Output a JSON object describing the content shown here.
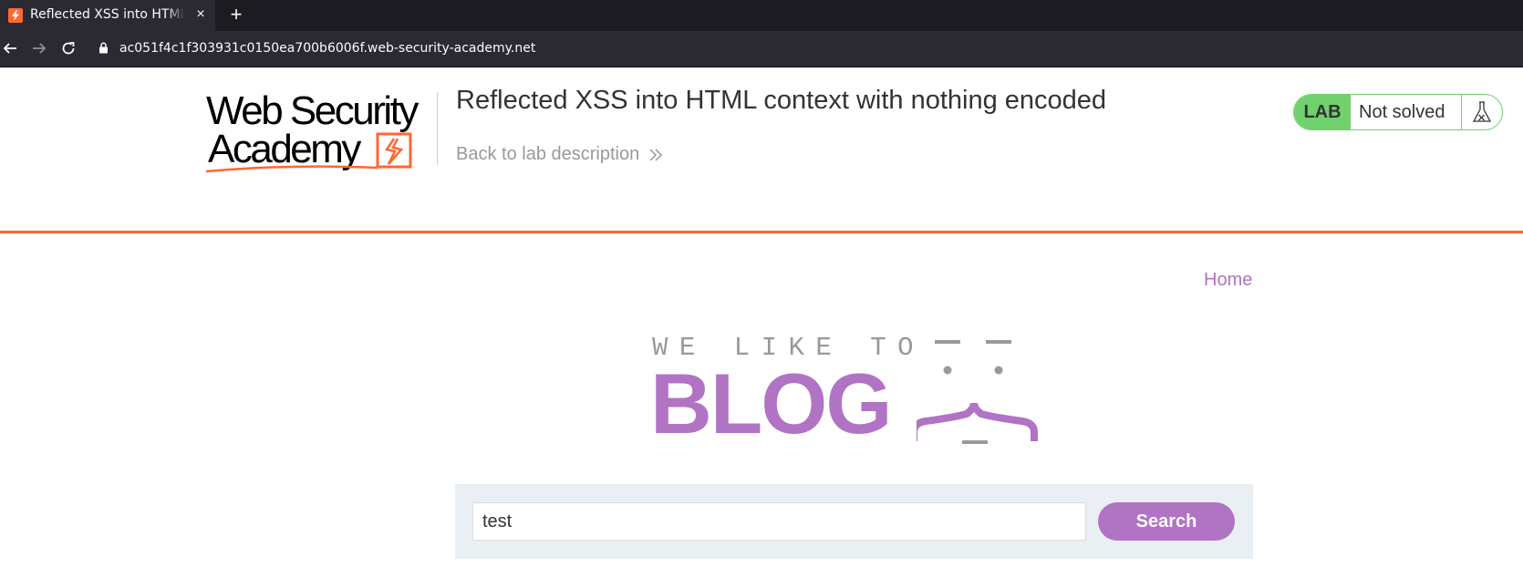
{
  "browser": {
    "tab_title": "Reflected XSS into HTML context with nothing encoded",
    "tab_close": "×",
    "new_tab": "+",
    "url": "ac051f4c1f303931c0150ea700b6006f.web-security-academy.net"
  },
  "academy": {
    "logo_line1": "Web Security",
    "logo_line2": "Academy",
    "lab_title": "Reflected XSS into HTML context with nothing encoded",
    "back_link": "Back to lab description",
    "lab_badge": "LAB",
    "lab_status": "Not solved",
    "accent_color": "#ff6633",
    "status_color": "#70d16d"
  },
  "blog": {
    "nav_home": "Home",
    "logo_tagline": "WE LIKE TO",
    "logo_word": "BLOG",
    "brand_color": "#b173c4",
    "search": {
      "value": "test",
      "button_label": "Search"
    }
  },
  "icons": [
    "back-arrow-icon",
    "forward-arrow-icon",
    "reload-icon",
    "lock-icon",
    "flask-icon",
    "double-chevron-icon",
    "portswigger-favicon-icon"
  ]
}
